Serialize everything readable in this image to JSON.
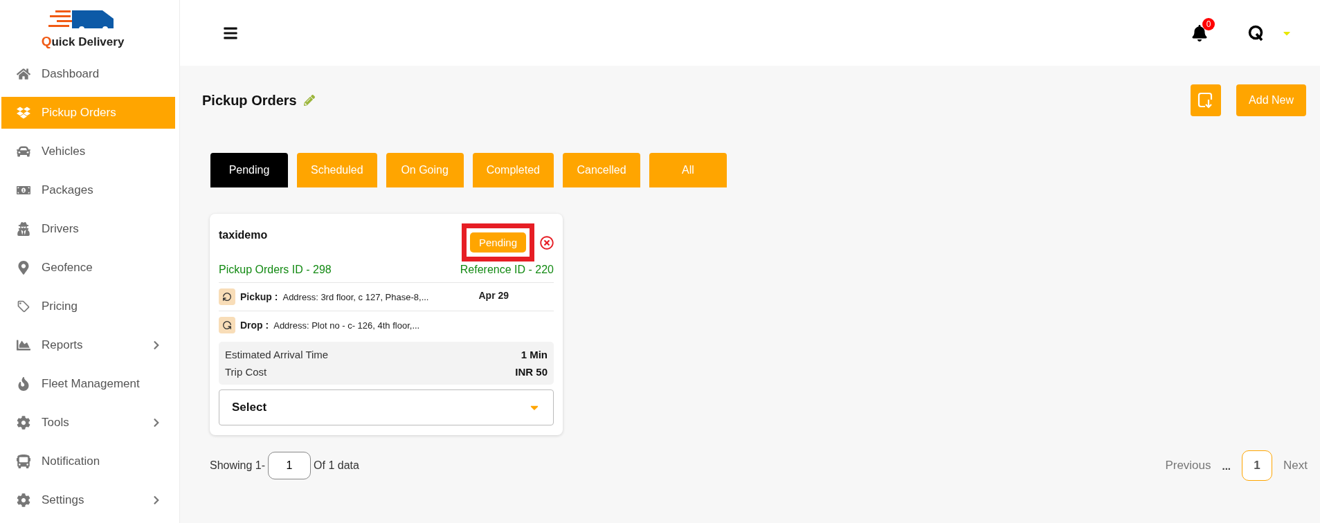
{
  "brand": {
    "initial": "Q",
    "rest": "uick Delivery"
  },
  "sidebar": {
    "items": [
      {
        "label": "Dashboard",
        "selected": false,
        "has_submenu": false
      },
      {
        "label": "Pickup Orders",
        "selected": true,
        "has_submenu": false
      },
      {
        "label": "Vehicles",
        "selected": false,
        "has_submenu": false
      },
      {
        "label": "Packages",
        "selected": false,
        "has_submenu": false
      },
      {
        "label": "Drivers",
        "selected": false,
        "has_submenu": false
      },
      {
        "label": "Geofence",
        "selected": false,
        "has_submenu": false
      },
      {
        "label": "Pricing",
        "selected": false,
        "has_submenu": false
      },
      {
        "label": "Reports",
        "selected": false,
        "has_submenu": true
      },
      {
        "label": "Fleet Management",
        "selected": false,
        "has_submenu": false
      },
      {
        "label": "Tools",
        "selected": false,
        "has_submenu": true
      },
      {
        "label": "Notification",
        "selected": false,
        "has_submenu": false
      },
      {
        "label": "Settings",
        "selected": false,
        "has_submenu": true
      }
    ]
  },
  "header": {
    "notification_count": "0"
  },
  "page": {
    "title": "Pickup Orders",
    "add_button": "Add New"
  },
  "tabs": [
    {
      "label": "Pending",
      "selected": true
    },
    {
      "label": "Scheduled",
      "selected": false
    },
    {
      "label": "On Going",
      "selected": false
    },
    {
      "label": "Completed",
      "selected": false
    },
    {
      "label": "Cancelled",
      "selected": false
    },
    {
      "label": "All",
      "selected": false
    }
  ],
  "cards": [
    {
      "customer": "taxidemo",
      "status": "Pending",
      "highlighted": true,
      "order_id": "Pickup Orders ID - 298",
      "reference_id": "Reference ID - 220",
      "pickup_label": "Pickup :",
      "pickup_address": "Address: 3rd floor, c 127, Phase-8,...",
      "pickup_date": "Apr 29",
      "drop_label": "Drop :",
      "drop_address": "Address: Plot no - c- 126, 4th floor,...",
      "details": [
        {
          "label": "Estimated Arrival Time",
          "value": "1 Min"
        },
        {
          "label": "Trip Cost",
          "value": "INR 50"
        }
      ],
      "select_value": "Select"
    }
  ],
  "pagination": {
    "showing_prefix": "Showing 1-",
    "page_input": "1",
    "showing_suffix": "Of 1 data",
    "previous": "Previous",
    "ellipsis": "...",
    "pages": [
      {
        "label": "1",
        "selected": true
      }
    ],
    "next": "Next"
  }
}
